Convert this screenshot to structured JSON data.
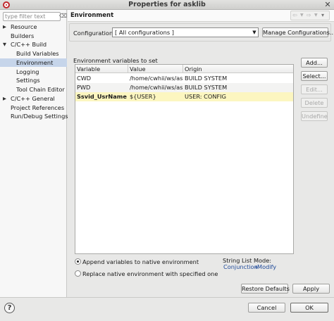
{
  "window": {
    "title": "Properties for asklib",
    "close_glyph": "✕"
  },
  "sidebar": {
    "filter_placeholder": "type filter text",
    "items": [
      {
        "label": "Resource",
        "expandable": true
      },
      {
        "label": "Builders",
        "expandable": false
      },
      {
        "label": "C/C++ Build",
        "expandable": true,
        "expanded": true
      },
      {
        "label": "Build Variables",
        "expandable": false
      },
      {
        "label": "Environment",
        "expandable": false,
        "selected": true
      },
      {
        "label": "Logging",
        "expandable": false
      },
      {
        "label": "Settings",
        "expandable": false
      },
      {
        "label": "Tool Chain Editor",
        "expandable": false
      },
      {
        "label": "C/C++ General",
        "expandable": true
      },
      {
        "label": "Project References",
        "expandable": false
      },
      {
        "label": "Run/Debug Settings",
        "expandable": false
      }
    ]
  },
  "page": {
    "title": "Environment",
    "configuration_label": "Configuration:",
    "configuration_value": "[ All configurations ]",
    "manage_button": "Manage Configurations...",
    "env_section_label": "Environment variables to set",
    "columns": [
      "Variable",
      "Value",
      "Origin"
    ],
    "rows": [
      {
        "variable": "CWD",
        "value": "/home/cwhii/ws/ask",
        "origin": "BUILD SYSTEM",
        "style": "normal"
      },
      {
        "variable": "PWD",
        "value": "/home/cwhii/ws/ask",
        "origin": "BUILD SYSTEM",
        "style": "alt"
      },
      {
        "variable": "Ssvid_UsrName",
        "value": "${USER}",
        "origin": "USER: CONFIG",
        "style": "user"
      }
    ],
    "side_buttons": {
      "add": "Add...",
      "select": "Select...",
      "edit": "Edit...",
      "delete": "Delete",
      "undefine": "Undefine"
    },
    "append_option": "Append variables to native environment",
    "replace_option": "Replace native environment with specified one",
    "append_checked": true,
    "string_list_mode_label": "String List Mode:",
    "string_list_conjunction": "Conjunction",
    "string_list_plus": "+",
    "string_list_modify": "Modify",
    "restore_button": "Restore Defaults",
    "apply_button": "Apply"
  },
  "footer": {
    "help_glyph": "?",
    "cancel_button": "Cancel",
    "ok_button": "OK"
  }
}
